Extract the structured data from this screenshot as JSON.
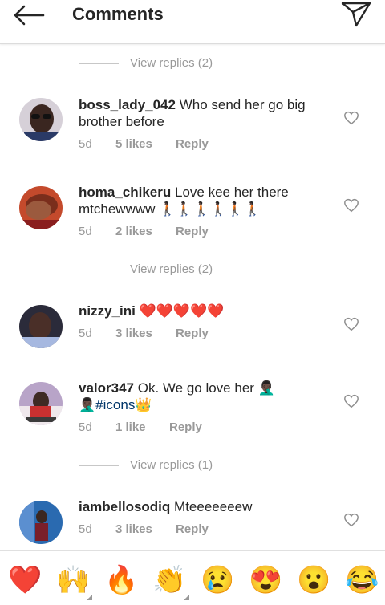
{
  "header": {
    "title": "Comments"
  },
  "view_replies": [
    "View replies (2)",
    "View replies (2)",
    "View replies (1)"
  ],
  "comments": [
    {
      "username": "boss_lady_042",
      "text": "Who send her go big brother before",
      "time": "5d",
      "likes": "5 likes",
      "reply": "Reply"
    },
    {
      "username": "homa_chikeru",
      "text": "Love kee her there mtchewwww 🚶🏿🚶🏿🚶🏿🚶🏿🚶🏿🚶🏿",
      "time": "5d",
      "likes": "2 likes",
      "reply": "Reply"
    },
    {
      "username": "nizzy_ini",
      "text": "❤️❤️❤️❤️❤️",
      "time": "5d",
      "likes": "3 likes",
      "reply": "Reply"
    },
    {
      "username": "valor347",
      "text": "Ok. We go love her 🤦🏿‍♂️",
      "text2": "🤦🏿‍♂️",
      "hashtag": "#icons",
      "crown": "👑",
      "time": "5d",
      "likes": "1 like",
      "reply": "Reply"
    },
    {
      "username": "iambellosodiq",
      "text": "Mteeeeeeew",
      "time": "5d",
      "likes": "3 likes",
      "reply": "Reply"
    }
  ],
  "emoji_bar": [
    "❤️",
    "🙌",
    "🔥",
    "👏",
    "😢",
    "😍",
    "😮",
    "😂"
  ],
  "colors": {
    "accent": "#262626",
    "secondary": "#999999",
    "heart": "#ed4956"
  }
}
